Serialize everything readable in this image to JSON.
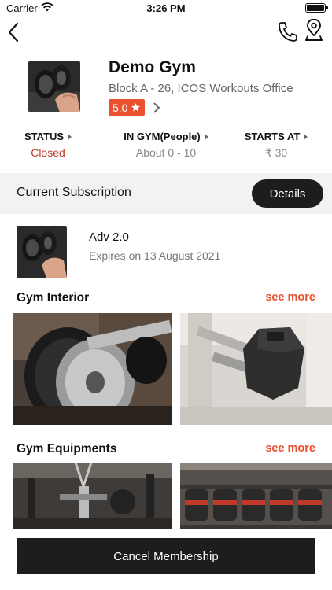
{
  "status_bar": {
    "carrier": "Carrier",
    "time": "3:26 PM"
  },
  "gym": {
    "name": "Demo Gym",
    "address": "Block A - 26, ICOS Workouts Office",
    "rating": "5.0"
  },
  "stats": [
    {
      "label": "STATUS",
      "value": "Closed"
    },
    {
      "label": "IN GYM(People)",
      "value": "About 0 - 10"
    },
    {
      "label": "STARTS AT",
      "value": "₹ 30"
    }
  ],
  "subscription": {
    "title": "Current Subscription",
    "details_label": "Details",
    "plan_name": "Adv 2.0",
    "expires": "Expires on 13 August 2021"
  },
  "sections": {
    "interior": {
      "title": "Gym Interior",
      "see_more": "see more"
    },
    "equipments": {
      "title": "Gym Equipments",
      "see_more": "see more"
    }
  },
  "cancel_label": "Cancel Membership",
  "colors": {
    "accent": "#e9512f",
    "dark": "#1d1d1d",
    "closed": "#c0392b"
  },
  "icons": [
    "wifi-icon",
    "battery-icon",
    "back-chevron-icon",
    "phone-icon",
    "location-pin-icon",
    "star-icon",
    "chevron-right-icon",
    "triangle-right-icon"
  ]
}
